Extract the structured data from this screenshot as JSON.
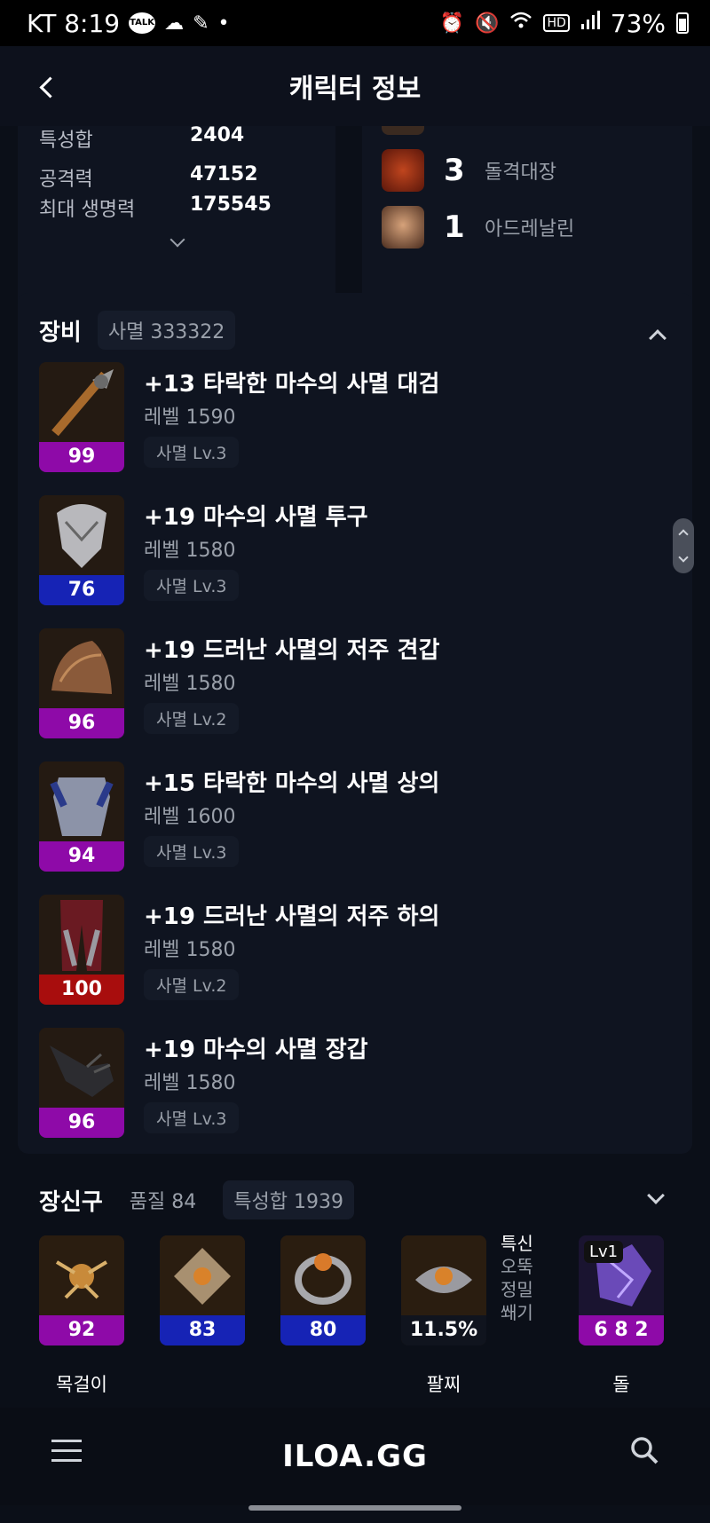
{
  "status_bar": {
    "carrier_time": "KT 8:19",
    "talk": "TALK",
    "battery": "73%"
  },
  "header": {
    "title": "캐릭터 정보"
  },
  "stats": {
    "rows": [
      {
        "label": "특성합",
        "value": "2404"
      },
      {
        "label": "공격력",
        "value": "47152"
      },
      {
        "label": "최대 생명력",
        "value": "175545"
      }
    ]
  },
  "engravings": [
    {
      "level": "3",
      "name": "돌격대장"
    },
    {
      "level": "1",
      "name": "아드레날린"
    }
  ],
  "equipment": {
    "title": "장비",
    "subtitle": "사멸 333322",
    "items": [
      {
        "name": "+13 타락한 마수의 사멸 대검",
        "level": "레벨 1590",
        "tag": "사멸 Lv.3",
        "quality": "99",
        "qcolor": "#8e0aa8"
      },
      {
        "name": "+19 마수의 사멸 투구",
        "level": "레벨 1580",
        "tag": "사멸 Lv.3",
        "quality": "76",
        "qcolor": "#1623b5"
      },
      {
        "name": "+19 드러난 사멸의 저주 견갑",
        "level": "레벨 1580",
        "tag": "사멸 Lv.2",
        "quality": "96",
        "qcolor": "#8e0aa8"
      },
      {
        "name": "+15 타락한 마수의 사멸 상의",
        "level": "레벨 1600",
        "tag": "사멸 Lv.3",
        "quality": "94",
        "qcolor": "#8e0aa8"
      },
      {
        "name": "+19 드러난 사멸의 저주 하의",
        "level": "레벨 1580",
        "tag": "사멸 Lv.2",
        "quality": "100",
        "qcolor": "#a80d0d"
      },
      {
        "name": "+19 마수의 사멸 장갑",
        "level": "레벨 1580",
        "tag": "사멸 Lv.3",
        "quality": "96",
        "qcolor": "#8e0aa8"
      }
    ]
  },
  "accessories": {
    "title": "장신구",
    "quality_chip": "품질 84",
    "stat_chip": "특성합 1939",
    "items": [
      {
        "quality": "92",
        "qcolor": "#8e0aa8",
        "label": "목걸이"
      },
      {
        "quality": "83",
        "qcolor": "#1623b5",
        "label": ""
      },
      {
        "quality": "80",
        "qcolor": "#1623b5",
        "label": ""
      },
      {
        "quality": "11.5%",
        "qcolor": "#10141e",
        "label": "팔찌"
      },
      {
        "quality": "6 8 2",
        "qcolor": "#8e0aa8",
        "label": "돌",
        "badge": "Lv1"
      }
    ],
    "bracelet_effects": [
      "특신",
      "오뚝",
      "정밀",
      "쐐기"
    ]
  },
  "bottom_nav": {
    "logo": "ILOA.GG"
  }
}
